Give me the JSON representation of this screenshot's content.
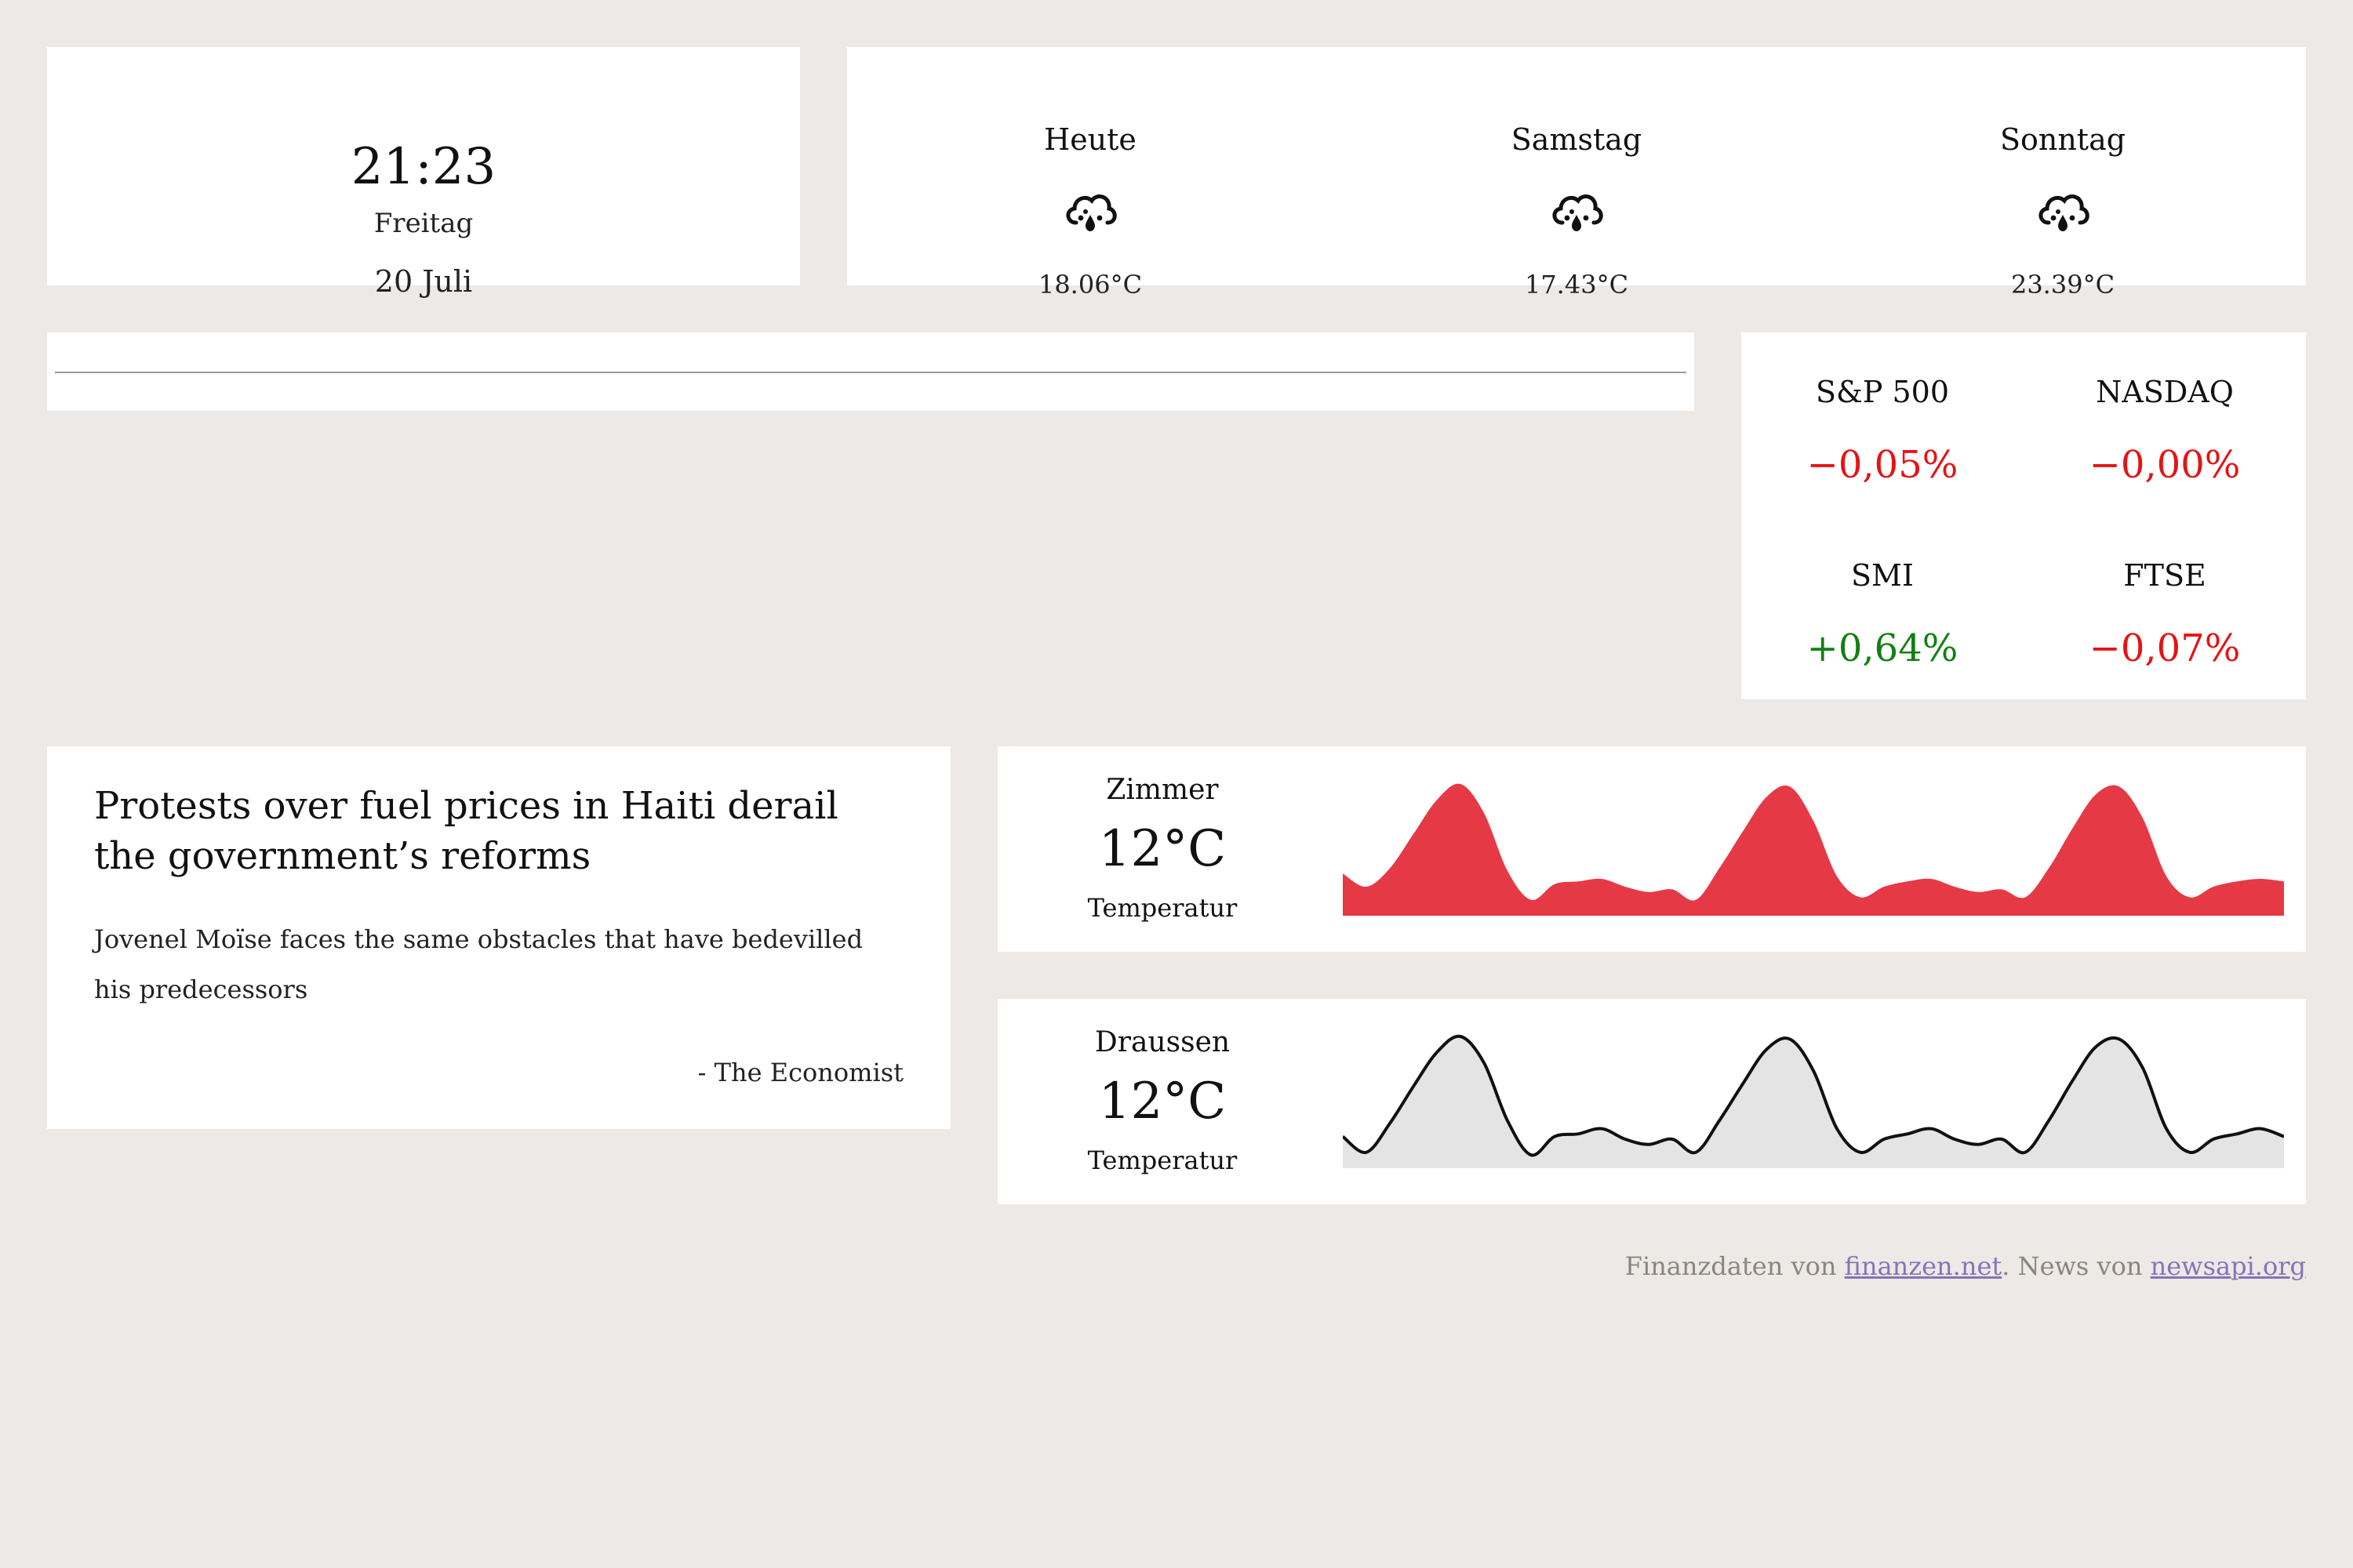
{
  "clock": {
    "time": "21:23",
    "weekday": "Freitag",
    "date": "20 Juli"
  },
  "weather": {
    "days": [
      {
        "name": "Heute",
        "icon": "rain-cloud-icon",
        "temp": "18.06°C"
      },
      {
        "name": "Samstag",
        "icon": "rain-cloud-icon",
        "temp": "17.43°C"
      },
      {
        "name": "Sonntag",
        "icon": "rain-cloud-icon",
        "temp": "23.39°C"
      }
    ]
  },
  "markets": [
    {
      "name": "S&P 500",
      "change": "−0,05%",
      "trend": "negative"
    },
    {
      "name": "NASDAQ",
      "change": "−0,00%",
      "trend": "negative"
    },
    {
      "name": "SMI",
      "change": "+0,64%",
      "trend": "positive"
    },
    {
      "name": "FTSE",
      "change": "−0,07%",
      "trend": "negative"
    }
  ],
  "colors": {
    "background": "#ece9e6",
    "negative": "#e41414",
    "positive": "#118011",
    "zimmer_fill": "#e63946",
    "draussen_fill": "#e4e4e4",
    "draussen_line": "#111111",
    "link": "#8a72b8"
  },
  "news": {
    "headline": "Protests over fuel prices in Haiti derail the government’s reforms",
    "description": "Jovenel Moïse faces the same obstacles that have bedevilled his predecessors",
    "source": "- The Economist"
  },
  "sensors": [
    {
      "name": "Zimmer",
      "value": "12°C",
      "sub": "Temperatur",
      "series": [
        0.32,
        0.22,
        0.36,
        0.62,
        0.88,
        1.0,
        0.78,
        0.34,
        0.12,
        0.24,
        0.26,
        0.28,
        0.22,
        0.18,
        0.2,
        0.12,
        0.36,
        0.64,
        0.9,
        0.98,
        0.72,
        0.3,
        0.14,
        0.22,
        0.26,
        0.28,
        0.22,
        0.18,
        0.2,
        0.14,
        0.36,
        0.66,
        0.92,
        0.98,
        0.74,
        0.3,
        0.14,
        0.22,
        0.26,
        0.28,
        0.26
      ]
    },
    {
      "name": "Draussen",
      "value": "12°C",
      "sub": "Temperatur",
      "series": [
        0.24,
        0.12,
        0.34,
        0.62,
        0.88,
        1.0,
        0.8,
        0.36,
        0.1,
        0.24,
        0.26,
        0.3,
        0.22,
        0.18,
        0.22,
        0.12,
        0.36,
        0.64,
        0.9,
        0.98,
        0.74,
        0.3,
        0.12,
        0.22,
        0.26,
        0.3,
        0.22,
        0.18,
        0.22,
        0.12,
        0.36,
        0.66,
        0.92,
        0.98,
        0.76,
        0.3,
        0.12,
        0.22,
        0.26,
        0.3,
        0.24
      ]
    }
  ],
  "footer": {
    "prefix": "Finanzdaten von ",
    "link1": "finanzen.net",
    "middle": ". News von ",
    "link2": "newsapi.org"
  }
}
